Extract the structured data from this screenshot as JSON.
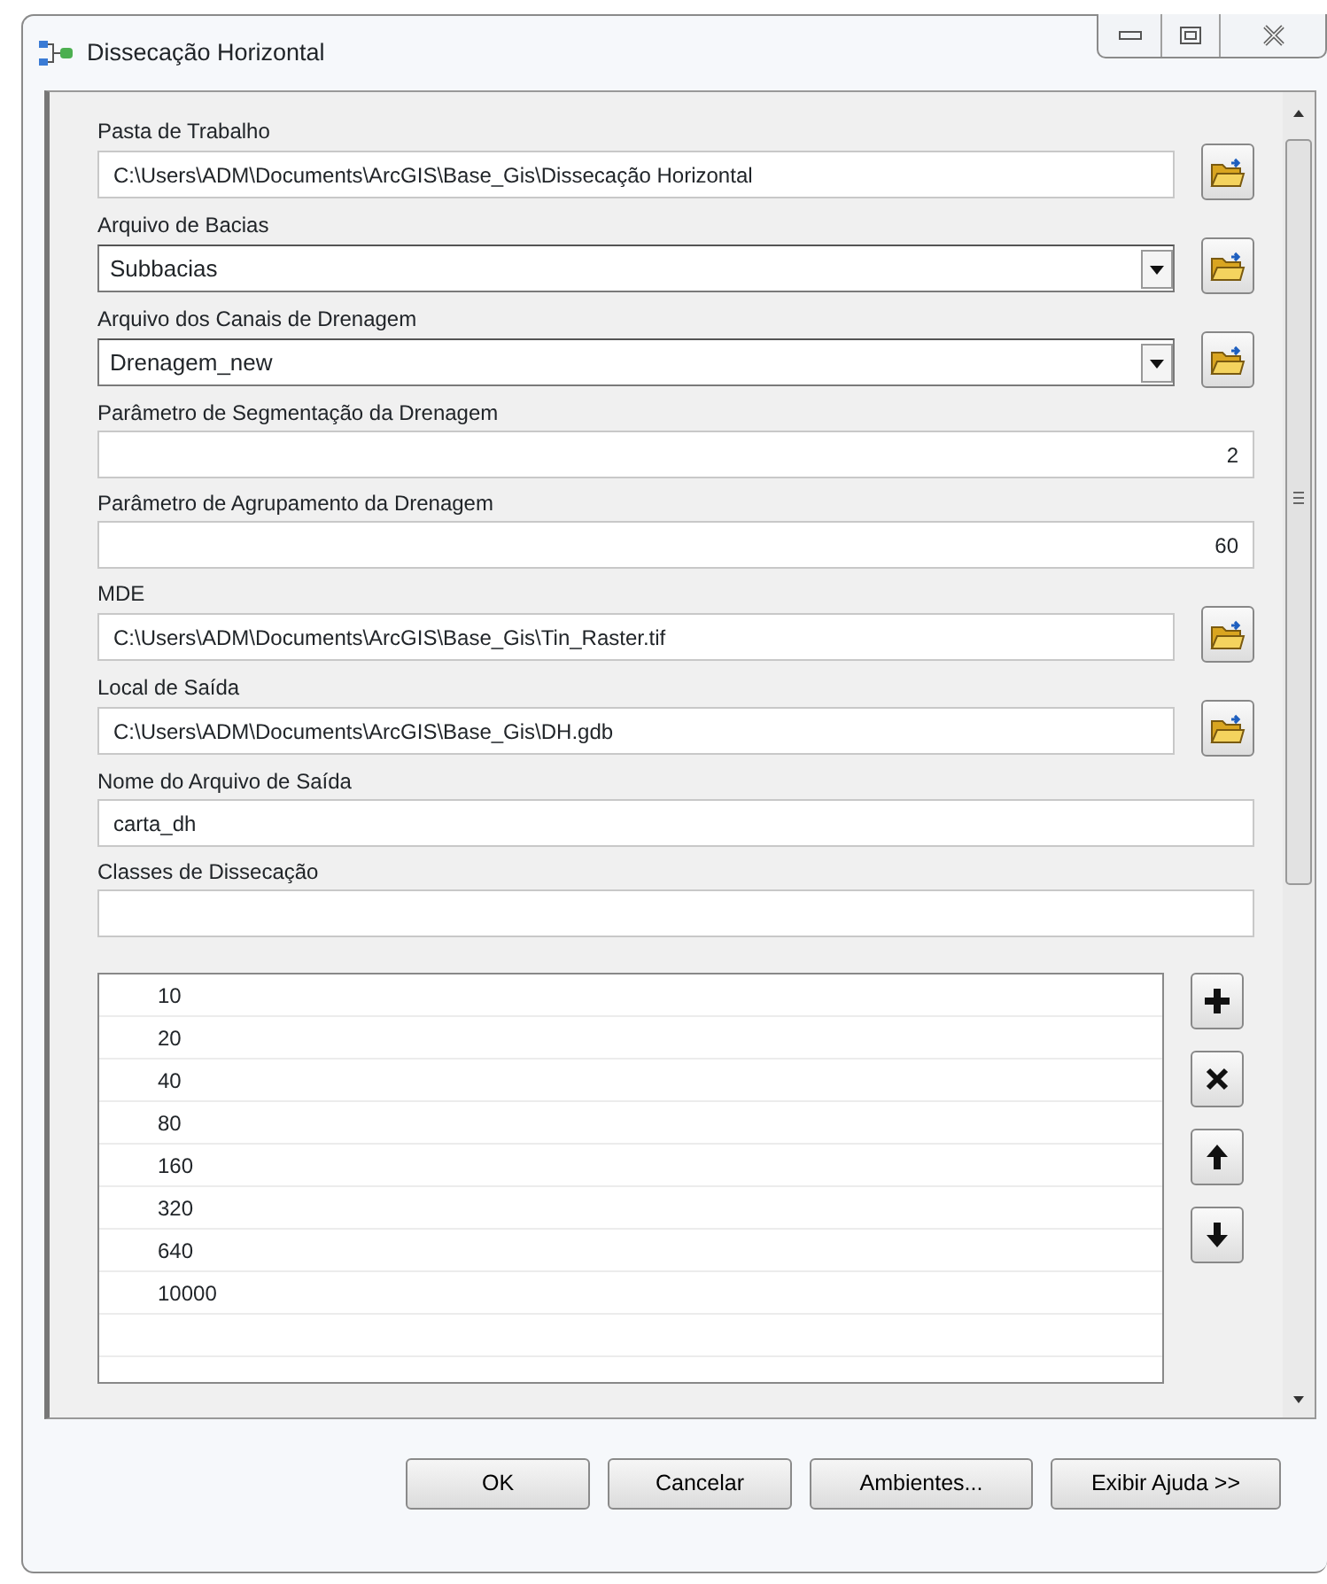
{
  "window": {
    "title": "Dissecação Horizontal"
  },
  "fields": [
    {
      "kind": "path",
      "label": "Pasta de Trabalho",
      "value": "C:\\Users\\ADM\\Documents\\ArcGIS\\Base_Gis\\Dissecação Horizontal"
    },
    {
      "kind": "combo",
      "label": "Arquivo de Bacias",
      "value": "Subbacias"
    },
    {
      "kind": "combo",
      "label": "Arquivo dos Canais de Drenagem",
      "value": "Drenagem_new"
    },
    {
      "kind": "number",
      "label": "Parâmetro de Segmentação da Drenagem",
      "value": "2"
    },
    {
      "kind": "number",
      "label": "Parâmetro de Agrupamento da Drenagem",
      "value": "60"
    },
    {
      "kind": "path",
      "label": "MDE",
      "value": "C:\\Users\\ADM\\Documents\\ArcGIS\\Base_Gis\\Tin_Raster.tif"
    },
    {
      "kind": "path",
      "label": "Local de Saída",
      "value": "C:\\Users\\ADM\\Documents\\ArcGIS\\Base_Gis\\DH.gdb"
    },
    {
      "kind": "text",
      "label": "Nome do Arquivo de Saída",
      "value": "carta_dh"
    },
    {
      "kind": "text",
      "label": "Classes de Dissecação"
    }
  ],
  "classes": [
    "10",
    "20",
    "40",
    "80",
    "160",
    "320",
    "640",
    "10000"
  ],
  "buttons": [
    "OK",
    "Cancelar",
    "Ambientes...",
    "Exibir Ajuda >>"
  ]
}
